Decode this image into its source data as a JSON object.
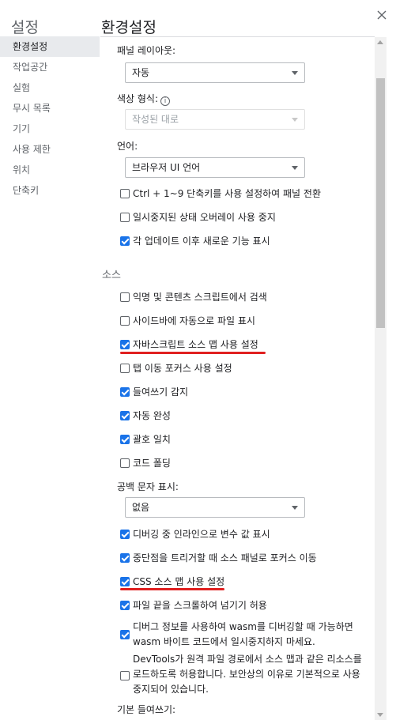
{
  "app_title": "설정",
  "page_title": "환경설정",
  "sidebar": {
    "items": [
      {
        "label": "환경설정"
      },
      {
        "label": "작업공간"
      },
      {
        "label": "실험"
      },
      {
        "label": "무시 목록"
      },
      {
        "label": "기기"
      },
      {
        "label": "사용 제한"
      },
      {
        "label": "위치"
      },
      {
        "label": "단축키"
      }
    ]
  },
  "appearance": {
    "panel_layout_label": "패널 레이아웃:",
    "panel_layout_value": "자동",
    "color_format_label": "색상 형식:",
    "color_format_value": "작성된 대로",
    "language_label": "언어:",
    "language_value": "브라우저 UI 언어",
    "shortcut_panel_switch": {
      "label": "Ctrl + 1~9 단축키를 사용 설정하여 패널 전환",
      "checked": false
    },
    "disable_paused_overlay": {
      "label": "일시중지된 상태 오버레이 사용 중지",
      "checked": false
    },
    "show_whats_new": {
      "label": "각 업데이트 이후 새로운 기능 표시",
      "checked": true
    }
  },
  "sources": {
    "section_title": "소스",
    "search_anonymous": {
      "label": "익명 및 콘텐츠 스크립트에서 검색",
      "checked": false
    },
    "auto_reveal_sidebar": {
      "label": "사이드바에 자동으로 파일 표시",
      "checked": false
    },
    "js_source_maps": {
      "label": "자바스크립트 소스 맵 사용 설정",
      "checked": true
    },
    "tab_focus": {
      "label": "탭 이동 포커스 사용 설정",
      "checked": false
    },
    "detect_indentation": {
      "label": "들여쓰기 감지",
      "checked": true
    },
    "autocompletion": {
      "label": "자동 완성",
      "checked": true
    },
    "bracket_matching": {
      "label": "괄호 일치",
      "checked": true
    },
    "code_folding": {
      "label": "코드 폴딩",
      "checked": false
    },
    "whitespace_label": "공백 문자 표시:",
    "whitespace_value": "없음",
    "inline_variable_values": {
      "label": "디버깅 중 인라인으로 변수 값 표시",
      "checked": true
    },
    "focus_sources_on_breakpoint": {
      "label": "중단점을 트리거할 때 소스 패널로 포커스 이동",
      "checked": true
    },
    "css_source_maps": {
      "label": "CSS 소스 맵 사용 설정",
      "checked": true
    },
    "scroll_past_end": {
      "label": "파일 끝을 스크롤하여 넘기기 허용",
      "checked": true
    },
    "wasm_debug_info": {
      "label": "디버그 정보를 사용하여 wasm를 디버깅할 때 가능하면 wasm 바이트 코드에서 일시중지하지 마세요.",
      "checked": true
    },
    "remote_file_paths": {
      "label": "DevTools가 원격 파일 경로에서 소스 맵과 같은 리소스를 로드하도록 허용합니다. 보안상의 이유로 기본적으로 사용 중지되어 있습니다.",
      "checked": false
    },
    "default_indentation_label": "기본 들여쓰기:"
  },
  "colors": {
    "accent": "#1a73e8",
    "highlight_underline": "#e02020",
    "sidebar_active_bg": "#e8eaed"
  }
}
